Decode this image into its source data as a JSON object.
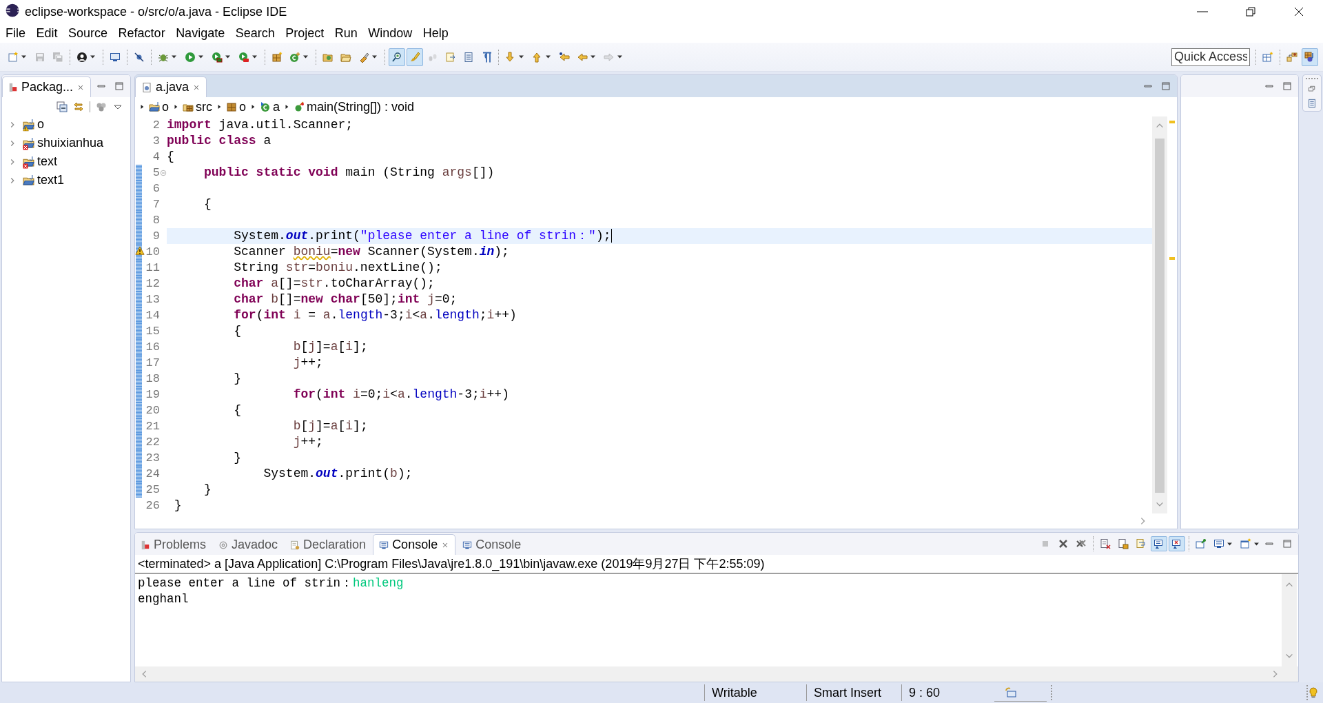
{
  "window": {
    "title": "eclipse-workspace - o/src/o/a.java - Eclipse IDE"
  },
  "menu": [
    "File",
    "Edit",
    "Source",
    "Refactor",
    "Navigate",
    "Search",
    "Project",
    "Run",
    "Window",
    "Help"
  ],
  "toolbar": {
    "groups": [
      [
        {
          "dropdown": true,
          "pressed": false,
          "disabled": false
        },
        {
          "dropdown": false,
          "pressed": false,
          "disabled": true
        },
        {
          "dropdown": false,
          "pressed": false,
          "disabled": true
        }
      ],
      [
        {
          "dropdown": true,
          "pressed": false,
          "disabled": false
        }
      ],
      [
        {
          "dropdown": false,
          "pressed": false,
          "disabled": false
        }
      ],
      [
        {
          "dropdown": false,
          "pressed": false,
          "disabled": false
        }
      ],
      [
        {
          "dropdown": true,
          "pressed": false,
          "disabled": false
        },
        {
          "dropdown": true,
          "pressed": false,
          "disabled": false
        },
        {
          "dropdown": true,
          "pressed": false,
          "disabled": false
        },
        {
          "dropdown": true,
          "pressed": false,
          "disabled": false
        }
      ],
      [
        {
          "dropdown": false,
          "pressed": false,
          "disabled": false
        },
        {
          "dropdown": true,
          "pressed": false,
          "disabled": false
        }
      ],
      [
        {
          "dropdown": false,
          "pressed": false,
          "disabled": false
        },
        {
          "dropdown": false,
          "pressed": false,
          "disabled": false
        },
        {
          "dropdown": true,
          "pressed": false,
          "disabled": false
        }
      ],
      [
        {
          "dropdown": false,
          "pressed": true,
          "disabled": false
        },
        {
          "dropdown": false,
          "pressed": true,
          "disabled": false
        },
        {
          "dropdown": false,
          "pressed": false,
          "disabled": true
        },
        {
          "dropdown": false,
          "pressed": false,
          "disabled": false
        },
        {
          "dropdown": false,
          "pressed": false,
          "disabled": false
        },
        {
          "dropdown": false,
          "pressed": false,
          "disabled": false
        }
      ],
      [
        {
          "dropdown": true,
          "pressed": false,
          "disabled": false
        },
        {
          "dropdown": true,
          "pressed": false,
          "disabled": false
        },
        {
          "dropdown": false,
          "pressed": false,
          "disabled": false
        },
        {
          "dropdown": true,
          "pressed": false,
          "disabled": false
        },
        {
          "dropdown": true,
          "pressed": false,
          "disabled": true
        }
      ]
    ],
    "quick_access": {
      "placeholder": "Quick Access"
    },
    "perspectives": [
      {
        "selected": false
      },
      {
        "selected": false
      },
      {
        "selected": true
      }
    ]
  },
  "package_explorer": {
    "tab": {
      "label": "Packag...",
      "selected": true
    },
    "items": [
      {
        "label": "o",
        "expanded": false,
        "has_warning": true,
        "has_error": false
      },
      {
        "label": "shuixianhua",
        "expanded": false,
        "has_warning": false,
        "has_error": true
      },
      {
        "label": "text",
        "expanded": false,
        "has_warning": false,
        "has_error": true
      },
      {
        "label": "text1",
        "expanded": false,
        "has_warning": false,
        "has_error": false
      }
    ]
  },
  "editor": {
    "tabs": [
      {
        "label": "a.java",
        "selected": true
      }
    ],
    "breadcrumb": [
      {
        "label": "o",
        "kind": "project"
      },
      {
        "label": "src",
        "kind": "source-folder"
      },
      {
        "label": "o",
        "kind": "package"
      },
      {
        "label": "a",
        "kind": "class"
      },
      {
        "label": "main(String[]) : void",
        "kind": "method"
      }
    ],
    "lines": [
      {
        "number": "2",
        "changed": false,
        "current": false,
        "tokens": [
          {
            "kind": "keyword",
            "text": "import"
          },
          {
            "kind": "plain",
            "text": " java.util.Scanner;"
          }
        ]
      },
      {
        "number": "3",
        "changed": false,
        "current": false,
        "tokens": [
          {
            "kind": "keyword",
            "text": "public class"
          },
          {
            "kind": "plain",
            "text": " a"
          }
        ]
      },
      {
        "number": "4",
        "changed": false,
        "current": false,
        "tokens": [
          {
            "kind": "plain",
            "text": "{"
          }
        ]
      },
      {
        "number": "5",
        "changed": true,
        "current": false,
        "collapsible": true,
        "tokens": [
          {
            "kind": "keyword",
            "text": "     public static void"
          },
          {
            "kind": "plain",
            "text": " main (String "
          },
          {
            "kind": "local",
            "text": "args"
          },
          {
            "kind": "plain",
            "text": "[])"
          }
        ]
      },
      {
        "number": "6",
        "changed": true,
        "current": false
      },
      {
        "number": "7",
        "changed": true,
        "current": false,
        "tokens": [
          {
            "kind": "plain",
            "text": "     {"
          }
        ]
      },
      {
        "number": "8",
        "changed": true,
        "current": false
      },
      {
        "number": "9",
        "changed": true,
        "current": true,
        "tokens": [
          {
            "kind": "plain",
            "text": "         System."
          },
          {
            "kind": "static-field",
            "text": "out"
          },
          {
            "kind": "plain",
            "text": ".print("
          },
          {
            "kind": "string",
            "text": "\"please enter a line of strin：\""
          },
          {
            "kind": "plain",
            "text": ");"
          }
        ]
      },
      {
        "number": "10",
        "changed": true,
        "current": false,
        "warning": true,
        "tokens": [
          {
            "kind": "plain",
            "text": "         Scanner "
          },
          {
            "kind": "local-warning",
            "text": "boniu"
          },
          {
            "kind": "plain",
            "text": "="
          },
          {
            "kind": "keyword",
            "text": "new"
          },
          {
            "kind": "plain",
            "text": " Scanner(System."
          },
          {
            "kind": "static-field",
            "text": "in"
          },
          {
            "kind": "plain",
            "text": ");"
          }
        ]
      },
      {
        "number": "11",
        "changed": true,
        "current": false,
        "tokens": [
          {
            "kind": "plain",
            "text": "         String "
          },
          {
            "kind": "local",
            "text": "str"
          },
          {
            "kind": "plain",
            "text": "="
          },
          {
            "kind": "local",
            "text": "boniu"
          },
          {
            "kind": "plain",
            "text": ".nextLine();"
          }
        ]
      },
      {
        "number": "12",
        "changed": true,
        "current": false,
        "tokens": [
          {
            "kind": "keyword",
            "text": "         char"
          },
          {
            "kind": "local",
            "text": " a"
          },
          {
            "kind": "plain",
            "text": "[]="
          },
          {
            "kind": "local",
            "text": "str"
          },
          {
            "kind": "plain",
            "text": ".toCharArray();"
          }
        ]
      },
      {
        "number": "13",
        "changed": true,
        "current": false,
        "tokens": [
          {
            "kind": "keyword",
            "text": "         char"
          },
          {
            "kind": "local",
            "text": " b"
          },
          {
            "kind": "plain",
            "text": "[]="
          },
          {
            "kind": "keyword",
            "text": "new char"
          },
          {
            "kind": "plain",
            "text": "[50];"
          },
          {
            "kind": "keyword",
            "text": "int"
          },
          {
            "kind": "local",
            "text": " j"
          },
          {
            "kind": "plain",
            "text": "=0;"
          }
        ]
      },
      {
        "number": "14",
        "changed": true,
        "current": false,
        "tokens": [
          {
            "kind": "keyword",
            "text": "         for"
          },
          {
            "kind": "plain",
            "text": "("
          },
          {
            "kind": "keyword",
            "text": "int"
          },
          {
            "kind": "local",
            "text": " i"
          },
          {
            "kind": "plain",
            "text": " = "
          },
          {
            "kind": "local",
            "text": "a"
          },
          {
            "kind": "plain",
            "text": "."
          },
          {
            "kind": "field",
            "text": "length"
          },
          {
            "kind": "plain",
            "text": "-3;"
          },
          {
            "kind": "local",
            "text": "i"
          },
          {
            "kind": "plain",
            "text": "<"
          },
          {
            "kind": "local",
            "text": "a"
          },
          {
            "kind": "plain",
            "text": "."
          },
          {
            "kind": "field",
            "text": "length"
          },
          {
            "kind": "plain",
            "text": ";"
          },
          {
            "kind": "local",
            "text": "i"
          },
          {
            "kind": "plain",
            "text": "++)"
          }
        ]
      },
      {
        "number": "15",
        "changed": true,
        "current": false,
        "tokens": [
          {
            "kind": "plain",
            "text": "         {"
          }
        ]
      },
      {
        "number": "16",
        "changed": true,
        "current": false,
        "tokens": [
          {
            "kind": "local",
            "text": "                 b"
          },
          {
            "kind": "plain",
            "text": "["
          },
          {
            "kind": "local",
            "text": "j"
          },
          {
            "kind": "plain",
            "text": "]="
          },
          {
            "kind": "local",
            "text": "a"
          },
          {
            "kind": "plain",
            "text": "["
          },
          {
            "kind": "local",
            "text": "i"
          },
          {
            "kind": "plain",
            "text": "];"
          }
        ]
      },
      {
        "number": "17",
        "changed": true,
        "current": false,
        "tokens": [
          {
            "kind": "local",
            "text": "                 j"
          },
          {
            "kind": "plain",
            "text": "++;"
          }
        ]
      },
      {
        "number": "18",
        "changed": true,
        "current": false,
        "tokens": [
          {
            "kind": "plain",
            "text": "         }"
          }
        ]
      },
      {
        "number": "19",
        "changed": true,
        "current": false,
        "tokens": [
          {
            "kind": "keyword",
            "text": "                 for"
          },
          {
            "kind": "plain",
            "text": "("
          },
          {
            "kind": "keyword",
            "text": "int"
          },
          {
            "kind": "local",
            "text": " i"
          },
          {
            "kind": "plain",
            "text": "=0;"
          },
          {
            "kind": "local",
            "text": "i"
          },
          {
            "kind": "plain",
            "text": "<"
          },
          {
            "kind": "local",
            "text": "a"
          },
          {
            "kind": "plain",
            "text": "."
          },
          {
            "kind": "field",
            "text": "length"
          },
          {
            "kind": "plain",
            "text": "-3;"
          },
          {
            "kind": "local",
            "text": "i"
          },
          {
            "kind": "plain",
            "text": "++)"
          }
        ]
      },
      {
        "number": "20",
        "changed": true,
        "current": false,
        "tokens": [
          {
            "kind": "plain",
            "text": "         {"
          }
        ]
      },
      {
        "number": "21",
        "changed": true,
        "current": false,
        "tokens": [
          {
            "kind": "local",
            "text": "                 b"
          },
          {
            "kind": "plain",
            "text": "["
          },
          {
            "kind": "local",
            "text": "j"
          },
          {
            "kind": "plain",
            "text": "]="
          },
          {
            "kind": "local",
            "text": "a"
          },
          {
            "kind": "plain",
            "text": "["
          },
          {
            "kind": "local",
            "text": "i"
          },
          {
            "kind": "plain",
            "text": "];"
          }
        ]
      },
      {
        "number": "22",
        "changed": true,
        "current": false,
        "tokens": [
          {
            "kind": "local",
            "text": "                 j"
          },
          {
            "kind": "plain",
            "text": "++;"
          }
        ]
      },
      {
        "number": "23",
        "changed": true,
        "current": false,
        "tokens": [
          {
            "kind": "plain",
            "text": "         }"
          }
        ]
      },
      {
        "number": "24",
        "changed": true,
        "current": false,
        "tokens": [
          {
            "kind": "plain",
            "text": "             System."
          },
          {
            "kind": "static-field",
            "text": "out"
          },
          {
            "kind": "plain",
            "text": ".print("
          },
          {
            "kind": "local",
            "text": "b"
          },
          {
            "kind": "plain",
            "text": ");"
          }
        ]
      },
      {
        "number": "25",
        "changed": true,
        "current": false,
        "tokens": [
          {
            "kind": "plain",
            "text": "     }"
          }
        ]
      },
      {
        "number": "26",
        "changed": false,
        "current": false,
        "tokens": [
          {
            "kind": "plain",
            "text": " }"
          }
        ]
      }
    ]
  },
  "console": {
    "tabs": [
      {
        "label": "Problems",
        "kind": "problems",
        "selected": false
      },
      {
        "label": "Javadoc",
        "kind": "javadoc",
        "selected": false
      },
      {
        "label": "Declaration",
        "kind": "declaration",
        "selected": false
      },
      {
        "label": "Console",
        "kind": "console",
        "selected": true
      },
      {
        "label": "Console",
        "kind": "console",
        "selected": false
      }
    ],
    "toolbar": [
      [
        {
          "dropdown": false,
          "pressed": false,
          "disabled": true
        },
        {
          "dropdown": false,
          "pressed": false,
          "disabled": false
        },
        {
          "dropdown": false,
          "pressed": false,
          "disabled": false
        }
      ],
      [
        {
          "dropdown": false,
          "pressed": false,
          "disabled": false
        },
        {
          "dropdown": false,
          "pressed": false,
          "disabled": false
        },
        {
          "dropdown": false,
          "pressed": false,
          "disabled": false
        },
        {
          "dropdown": false,
          "pressed": true,
          "disabled": false
        },
        {
          "dropdown": false,
          "pressed": true,
          "disabled": false
        }
      ],
      [
        {
          "dropdown": false,
          "pressed": false,
          "disabled": false
        },
        {
          "dropdown": true,
          "pressed": false,
          "disabled": false
        },
        {
          "dropdown": true,
          "pressed": false,
          "disabled": false
        }
      ]
    ],
    "header": "<terminated> a [Java Application] C:\\Program Files\\Java\\jre1.8.0_191\\bin\\javaw.exe (2019年9月27日 下午2:55:09)",
    "output": [
      [
        {
          "kind": "output",
          "text": "please enter a line of strin："
        },
        {
          "kind": "input",
          "text": "hanleng"
        }
      ],
      [
        {
          "kind": "output",
          "text": "enghanl"
        }
      ]
    ]
  },
  "status_bar": {
    "mode": "Writable",
    "insert_mode": "Smart Insert",
    "position": "9 : 60"
  }
}
